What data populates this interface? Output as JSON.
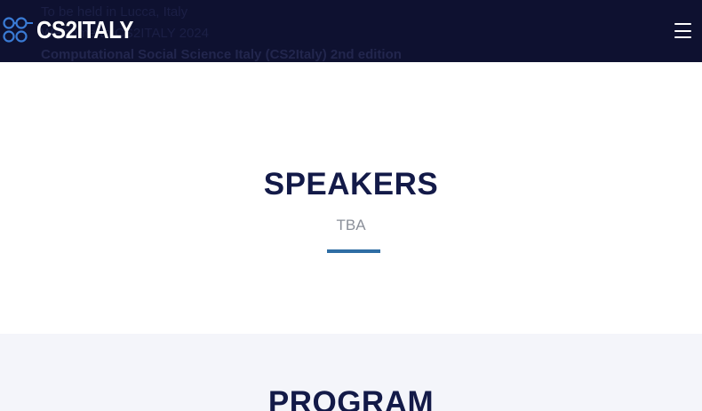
{
  "nav": {
    "logo_text": "CS2ITALY",
    "ghost_lines": [
      "To be held in Lucca, Italy",
      "Welcome to CS2ITALY 2024",
      "Computational Social Science Italy (CS2Italy) 2nd edition"
    ]
  },
  "speakers": {
    "title": "SPEAKERS",
    "subtitle": "TBA"
  },
  "program": {
    "title": "PROGRAM"
  },
  "colors": {
    "nav_bg": "#0e1130",
    "title": "#131a48",
    "accent": "#2e6da4",
    "subtitle": "#8a8f99",
    "alt_section_bg": "#f4f5fa"
  },
  "icons": {
    "logo": "linked-circles-logo-icon",
    "menu": "hamburger-menu-icon"
  }
}
